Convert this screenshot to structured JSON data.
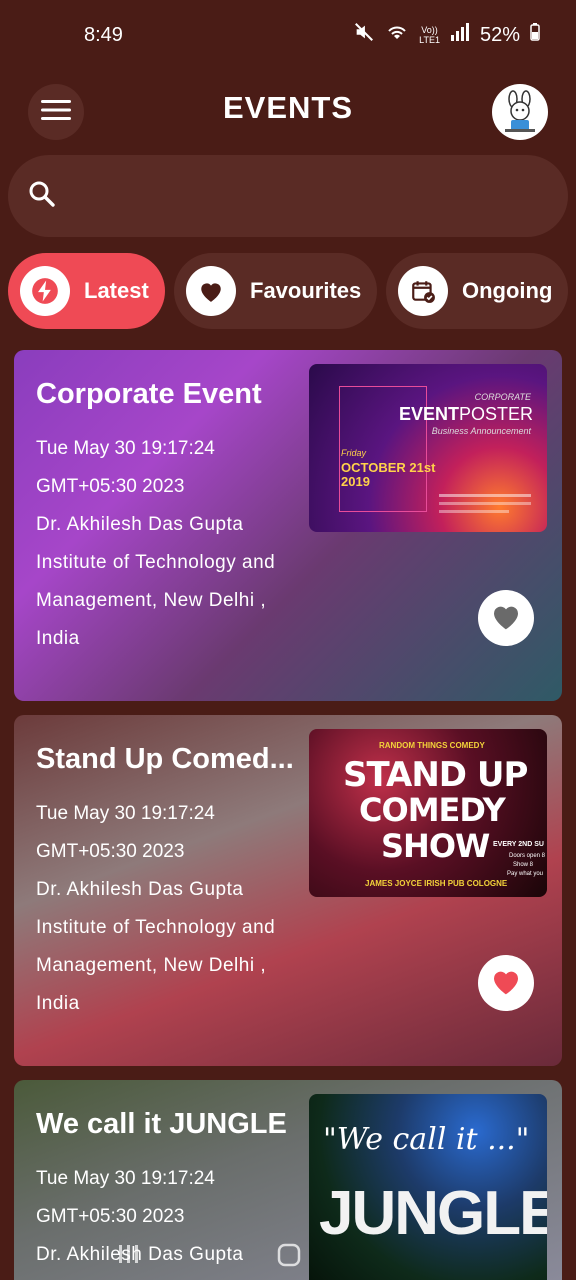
{
  "status": {
    "time": "8:49",
    "network_top": "Vo))",
    "network_bottom": "LTE1",
    "battery": "52%"
  },
  "header": {
    "title": "EVENTS"
  },
  "search": {
    "placeholder": ""
  },
  "tabs": [
    {
      "label": "Latest",
      "active": true
    },
    {
      "label": "Favourites",
      "active": false
    },
    {
      "label": "Ongoing",
      "active": false
    }
  ],
  "events": [
    {
      "name": "Corporate Event",
      "date": "Tue May 30 19:17:24 GMT+05:30 2023",
      "location": "Dr. Akhilesh Das Gupta Institute of Technology and Management, New Delhi , India",
      "favourite": false,
      "poster": {
        "line1": "CORPORATE",
        "line2a": "EVENT",
        "line2b": "POSTER",
        "line3": "Business Announcement",
        "day": "Friday",
        "date": "OCTOBER 21st",
        "year": "2019"
      }
    },
    {
      "name": "Stand Up Comed...",
      "date": "Tue May 30 19:17:24 GMT+05:30 2023",
      "location": "Dr. Akhilesh Das Gupta Institute of Technology and Management, New Delhi , India",
      "favourite": true,
      "poster": {
        "top": "RANDOM THINGS COMEDY",
        "line1": "STAND UP",
        "line2": "COMEDY",
        "line3": "SHOW",
        "side1": "EVERY 2ND SU",
        "side2": "Doors open 8",
        "side3": "Show 8",
        "side4": "Pay what you",
        "bottom": "JAMES JOYCE IRISH PUB COLOGNE"
      }
    },
    {
      "name": "We call it JUNGLE",
      "date": "Tue May 30 19:17:24 GMT+05:30 2023",
      "location": "Dr. Akhilesh Das Gupta",
      "favourite": false,
      "poster": {
        "line1": "\"We call it ...\"",
        "line2": "JUNGLE"
      }
    }
  ],
  "colors": {
    "background": "#4a1c16",
    "surface": "#5a2b25",
    "accent": "#ef4a55"
  }
}
